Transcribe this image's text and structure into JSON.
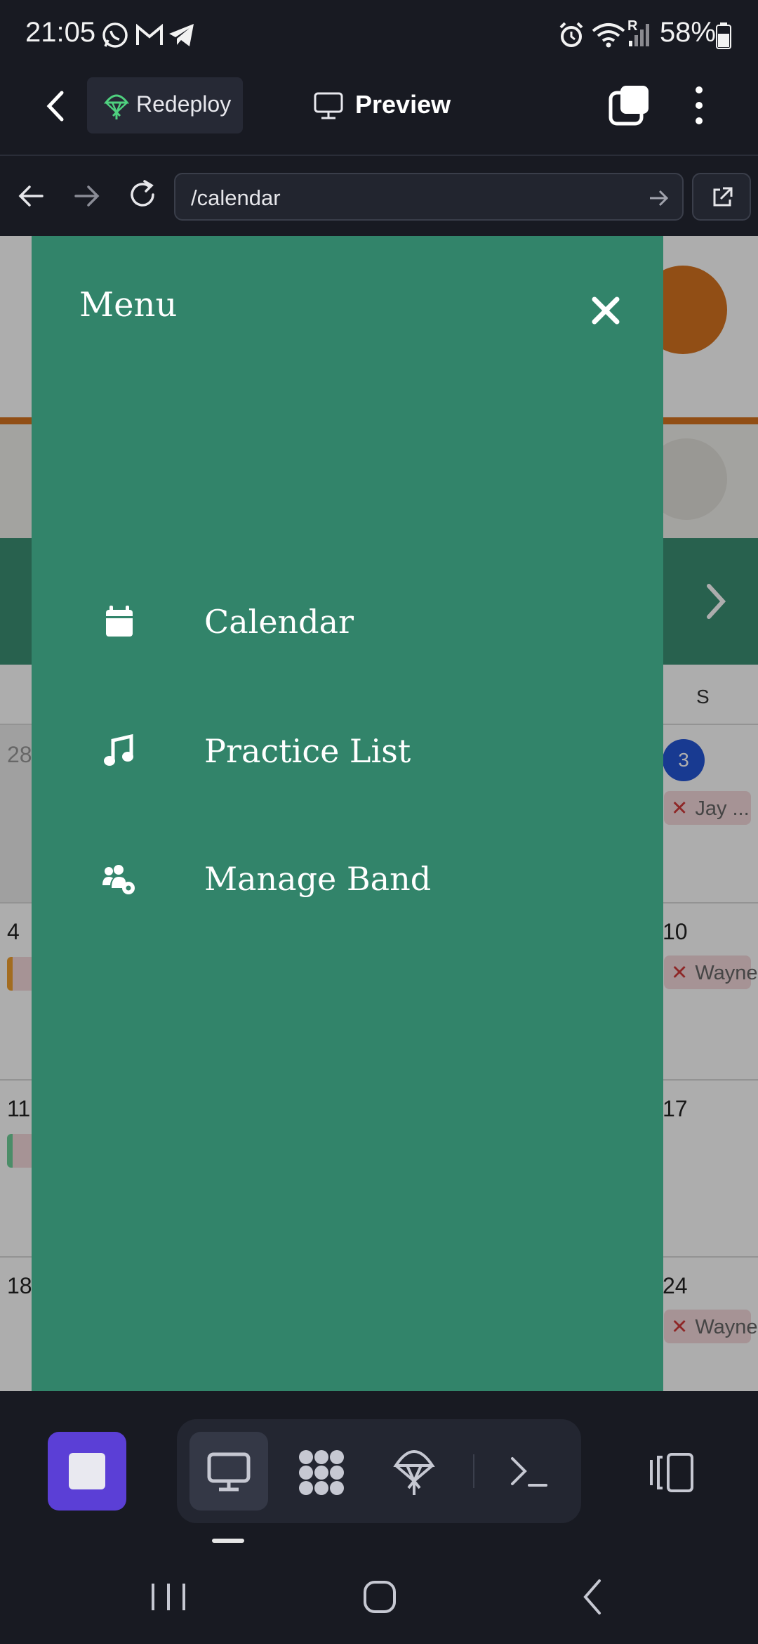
{
  "status_bar": {
    "time": "21:05",
    "battery": "58%",
    "roaming_indicator": "R",
    "icons": [
      "whatsapp-icon",
      "gmail-icon",
      "telegram-icon",
      "alarm-icon",
      "wifi-icon",
      "signal-icon",
      "battery-icon"
    ]
  },
  "app_header": {
    "redeploy_label": "Redeploy",
    "preview_label": "Preview"
  },
  "browser": {
    "url": "/calendar"
  },
  "background_calendar": {
    "weekday_label": "S",
    "badge_count": "3",
    "days": [
      "28",
      "4",
      "10",
      "11",
      "17",
      "18",
      "24"
    ],
    "events": [
      "Jay ...",
      "Wayne",
      "Wayne"
    ]
  },
  "menu": {
    "title": "Menu",
    "items": [
      {
        "label": "Calendar",
        "icon": "calendar-icon"
      },
      {
        "label": "Practice List",
        "icon": "music-note-icon"
      },
      {
        "label": "Manage Band",
        "icon": "users-gear-icon"
      }
    ]
  },
  "colors": {
    "drawer": "#32846a",
    "accent_stop": "#5b3fd6",
    "dark_bg": "#181a22"
  }
}
